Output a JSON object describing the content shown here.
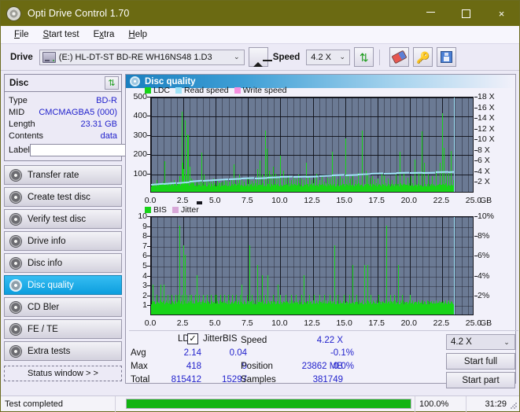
{
  "window": {
    "title": "Opti Drive Control 1.70",
    "icon": "disc-icon",
    "minimize": "minimize-icon",
    "maximize": "maximize-icon",
    "close": "×"
  },
  "menu": {
    "items": [
      {
        "label": "File",
        "accel": "F"
      },
      {
        "label": "Start test",
        "accel": "S"
      },
      {
        "label": "Extra",
        "accel": "x"
      },
      {
        "label": "Help",
        "accel": "H"
      }
    ]
  },
  "toolbar": {
    "drive_label": "Drive",
    "drive_value": "(E:)  HL-DT-ST BD-RE  WH16NS48 1.D3",
    "drive_icon": "drive-icon",
    "eject_icon": "eject-icon",
    "speed_label": "Speed",
    "speed_value": "4.2 X",
    "refresh_icon": "refresh-icon",
    "erase_icon": "eraser-icon",
    "key_icon": "key-icon",
    "save_icon": "floppy-disk-icon",
    "chevron": "⌄"
  },
  "disc_panel": {
    "title": "Disc",
    "refresh_icon": "refresh-icon",
    "rows": [
      {
        "key": "Type",
        "value": "BD-R"
      },
      {
        "key": "MID",
        "value": "CMCMAGBA5 (000)"
      },
      {
        "key": "Length",
        "value": "23.31 GB"
      },
      {
        "key": "Contents",
        "value": "data"
      }
    ],
    "label_key": "Label",
    "label_value": "",
    "label_placeholder": "",
    "disc_button_icon": "disc-icon"
  },
  "sidebar": {
    "items": [
      {
        "label": "Transfer rate",
        "icon": "disc-icon",
        "active": false
      },
      {
        "label": "Create test disc",
        "icon": "disc-icon",
        "active": false
      },
      {
        "label": "Verify test disc",
        "icon": "disc-icon",
        "active": false
      },
      {
        "label": "Drive info",
        "icon": "disc-icon",
        "active": false
      },
      {
        "label": "Disc info",
        "icon": "disc-icon",
        "active": false
      },
      {
        "label": "Disc quality",
        "icon": "disc-icon",
        "active": true
      },
      {
        "label": "CD Bler",
        "icon": "disc-icon",
        "active": false
      },
      {
        "label": "FE / TE",
        "icon": "disc-icon",
        "active": false
      },
      {
        "label": "Extra tests",
        "icon": "disc-icon",
        "active": false
      }
    ],
    "status_window": "Status window > >"
  },
  "panel": {
    "title": "Disc quality",
    "icon": "disc-icon"
  },
  "stats": {
    "col_headers": [
      "LDC",
      "BIS"
    ],
    "rows": [
      {
        "label": "Avg",
        "ldc": "2.14",
        "bis": "0.04",
        "jitter": "-0.1%"
      },
      {
        "label": "Max",
        "ldc": "418",
        "bis": "9",
        "jitter": "0.0%"
      },
      {
        "label": "Total",
        "ldc": "815412",
        "bis": "15297",
        "jitter": ""
      }
    ],
    "jitter_label": "Jitter",
    "jitter_checked": true,
    "jitter_check_glyph": "✓",
    "speed_label": "Speed",
    "speed_value": "4.22 X",
    "position_label": "Position",
    "position_value": "23862 MB",
    "samples_label": "Samples",
    "samples_value": "381749",
    "speed_select": "4.2 X",
    "speed_select_chevron": "⌄",
    "start_full": "Start full",
    "start_part": "Start part"
  },
  "statusbar": {
    "message": "Test completed",
    "percent_text": "100.0%",
    "percent_value": 100,
    "elapsed": "31:29"
  },
  "colors": {
    "titlebar": "#6b6a12",
    "accent_active": "#0c9ede",
    "ldc_green": "#18d318",
    "read_speed_cyan": "#9fe2f7",
    "write_speed_pink": "#f58fe0",
    "jitter_pink": "#d8a8d8",
    "plot_bg": "#6b7a94",
    "value_blue": "#2222cc",
    "progress_green": "#12b412"
  },
  "chart_data": [
    {
      "type": "bar",
      "title": "LDC / Read speed",
      "xlabel": "GB",
      "ylabel": "LDC",
      "xlim": [
        0,
        25
      ],
      "ylim": [
        0,
        500
      ],
      "y2lim": [
        0,
        18
      ],
      "y2label": "X",
      "grid": true,
      "legend_position": "top-left",
      "legend": [
        {
          "name": "LDC",
          "color": "#18d318"
        },
        {
          "name": "Read speed",
          "color": "#9fe2f7"
        },
        {
          "name": "Write speed",
          "color": "#f58fe0"
        }
      ],
      "xticks": [
        "0.0",
        "2.5",
        "5.0",
        "7.5",
        "10.0",
        "12.5",
        "15.0",
        "17.5",
        "20.0",
        "22.5",
        "25.0"
      ],
      "yticks": [
        100,
        200,
        300,
        400,
        500
      ],
      "y2ticks": [
        "2 X",
        "4 X",
        "6 X",
        "8 X",
        "10 X",
        "12 X",
        "14 X",
        "16 X",
        "18 X"
      ],
      "data_end_x": 23.4,
      "series": [
        {
          "name": "LDC",
          "color": "#18d318",
          "x": [
            0.05,
            0.18,
            0.3,
            0.45,
            0.6,
            0.75,
            0.9,
            1.05,
            1.2,
            1.35,
            1.5,
            1.62,
            1.75,
            1.9,
            2.05,
            2.2,
            2.35,
            2.45,
            2.52,
            2.6,
            2.68,
            2.78,
            2.88,
            2.98,
            3.08,
            3.18,
            3.3,
            3.45,
            3.6,
            3.75,
            3.9,
            4.05,
            4.2,
            4.35,
            4.5,
            4.65,
            4.8,
            4.95,
            5.1,
            5.25,
            5.4,
            5.55,
            5.7,
            5.85,
            6.0,
            6.2,
            6.4,
            6.6,
            6.8,
            7.0,
            7.2,
            7.4,
            7.6,
            7.8,
            8.0,
            8.2,
            8.4,
            8.6,
            8.8,
            8.95,
            9.1,
            9.25,
            9.4,
            9.6,
            9.8,
            10.0,
            10.2,
            10.4,
            10.6,
            10.8,
            11.0,
            11.2,
            11.4,
            11.6,
            11.8,
            12.0,
            12.2,
            12.4,
            12.6,
            12.8,
            13.0,
            13.2,
            13.4,
            13.6,
            13.8,
            14.0,
            14.2,
            14.4,
            14.6,
            14.8,
            15.0,
            15.2,
            15.4,
            15.6,
            15.8,
            16.0,
            16.3,
            16.6,
            16.7,
            16.9,
            17.1,
            17.3,
            17.5,
            17.8,
            18.0,
            18.3,
            18.6,
            18.9,
            19.2,
            19.5,
            19.8,
            20.1,
            20.4,
            20.7,
            20.9,
            21.1,
            21.4,
            21.7,
            22.0,
            22.3,
            22.5,
            22.6,
            22.8,
            23.0,
            23.2,
            23.35
          ],
          "values": [
            30,
            45,
            38,
            60,
            42,
            35,
            55,
            160,
            48,
            40,
            52,
            38,
            60,
            45,
            50,
            80,
            418,
            150,
            120,
            372,
            90,
            300,
            295,
            130,
            70,
            60,
            55,
            50,
            48,
            62,
            205,
            90,
            55,
            60,
            48,
            52,
            70,
            45,
            60,
            50,
            48,
            55,
            65,
            58,
            52,
            60,
            145,
            75,
            90,
            60,
            55,
            70,
            65,
            58,
            62,
            120,
            165,
            90,
            318,
            225,
            110,
            90,
            130,
            95,
            80,
            190,
            110,
            70,
            85,
            60,
            75,
            65,
            90,
            70,
            60,
            150,
            80,
            60,
            70,
            95,
            60,
            80,
            55,
            75,
            70,
            210,
            90,
            65,
            80,
            70,
            280,
            90,
            70,
            85,
            60,
            100,
            320,
            110,
            90,
            75,
            80,
            65,
            70,
            95,
            85,
            70,
            60,
            90,
            210,
            95,
            75,
            80,
            170,
            100,
            315,
            150,
            90,
            80,
            110,
            150,
            408,
            230,
            95,
            105,
            215,
            60
          ]
        },
        {
          "name": "Read speed",
          "color": "#9fe2f7",
          "x": [
            0.0,
            1.0,
            2.0,
            3.0,
            4.0,
            5.0,
            6.0,
            7.0,
            8.0,
            9.0,
            10.0,
            11.0,
            12.0,
            13.0,
            14.0,
            15.0,
            16.0,
            17.0,
            18.0,
            19.0,
            20.0,
            21.0,
            22.0,
            23.0,
            23.4
          ],
          "values_x": [
            1.7,
            1.9,
            2.1,
            2.3,
            2.5,
            2.65,
            2.8,
            2.9,
            3.0,
            3.1,
            3.2,
            3.25,
            3.3,
            3.4,
            3.5,
            3.6,
            3.7,
            3.8,
            3.9,
            3.95,
            4.0,
            4.05,
            4.1,
            4.15,
            4.2
          ]
        }
      ]
    },
    {
      "type": "bar",
      "title": "BIS / Jitter",
      "xlabel": "GB",
      "ylabel": "BIS",
      "xlim": [
        0,
        25
      ],
      "ylim": [
        0,
        10
      ],
      "y2lim": [
        0,
        10
      ],
      "y2label": "%",
      "grid": true,
      "legend_position": "top-left",
      "legend": [
        {
          "name": "BIS",
          "color": "#18d318"
        },
        {
          "name": "Jitter",
          "color": "#d8a8d8"
        }
      ],
      "xticks": [
        "0.0",
        "2.5",
        "5.0",
        "7.5",
        "10.0",
        "12.5",
        "15.0",
        "17.5",
        "20.0",
        "22.5",
        "25.0"
      ],
      "yticks": [
        1,
        2,
        3,
        4,
        5,
        6,
        7,
        8,
        9,
        10
      ],
      "y2ticks": [
        "2%",
        "4%",
        "6%",
        "8%",
        "10%"
      ],
      "data_end_x": 23.4,
      "series": [
        {
          "name": "BIS",
          "color": "#18d318",
          "x": [
            0.1,
            0.25,
            0.4,
            0.55,
            0.7,
            0.85,
            1.0,
            1.15,
            1.3,
            1.45,
            1.6,
            1.75,
            1.9,
            2.05,
            2.2,
            2.35,
            2.5,
            2.62,
            2.75,
            2.9,
            3.0,
            3.1,
            3.25,
            3.4,
            3.55,
            3.7,
            3.85,
            4.0,
            4.15,
            4.3,
            4.45,
            4.6,
            4.75,
            4.9,
            5.05,
            5.2,
            5.35,
            5.5,
            5.65,
            5.8,
            5.95,
            6.1,
            6.25,
            6.4,
            6.55,
            6.7,
            6.85,
            7.0,
            7.2,
            7.4,
            7.6,
            7.8,
            8.0,
            8.2,
            8.4,
            8.6,
            8.8,
            9.0,
            9.2,
            9.4,
            9.6,
            9.8,
            10.0,
            10.2,
            10.4,
            10.6,
            10.8,
            11.0,
            11.2,
            11.4,
            11.6,
            11.8,
            12.0,
            12.2,
            12.4,
            12.6,
            12.8,
            13.0,
            13.2,
            13.4,
            13.6,
            13.8,
            14.0,
            14.2,
            14.4,
            14.6,
            14.9,
            15.1,
            15.3,
            15.6,
            15.9,
            16.2,
            16.5,
            16.7,
            17.0,
            17.3,
            17.6,
            17.9,
            18.2,
            18.5,
            18.8,
            19.1,
            19.4,
            19.7,
            20.0,
            20.3,
            20.6,
            20.9,
            21.1,
            21.3,
            21.6,
            21.9,
            22.2,
            22.5,
            22.7,
            22.9,
            23.1,
            23.3
          ],
          "values": [
            3,
            1,
            2,
            1,
            3,
            1,
            3,
            1,
            2,
            1,
            2,
            1,
            2,
            2,
            9,
            2,
            7,
            6,
            2,
            1,
            2,
            2,
            1,
            2,
            4,
            2,
            1,
            2,
            1,
            2,
            1,
            2,
            1,
            2,
            2,
            1,
            2,
            1,
            2,
            1,
            2,
            1,
            2,
            1,
            2,
            1,
            2,
            3,
            1,
            2,
            7,
            2,
            1,
            5,
            2,
            4,
            2,
            4,
            1,
            2,
            1,
            3,
            2,
            1,
            2,
            1,
            2,
            1,
            2,
            1,
            2,
            4,
            1,
            2,
            1,
            2,
            1,
            2,
            1,
            2,
            1,
            2,
            1,
            7,
            2,
            1,
            2,
            1,
            2,
            5,
            2,
            1,
            5,
            5,
            2,
            1,
            2,
            1,
            9,
            2,
            2,
            5,
            2,
            1,
            2
          ]
        }
      ]
    }
  ]
}
